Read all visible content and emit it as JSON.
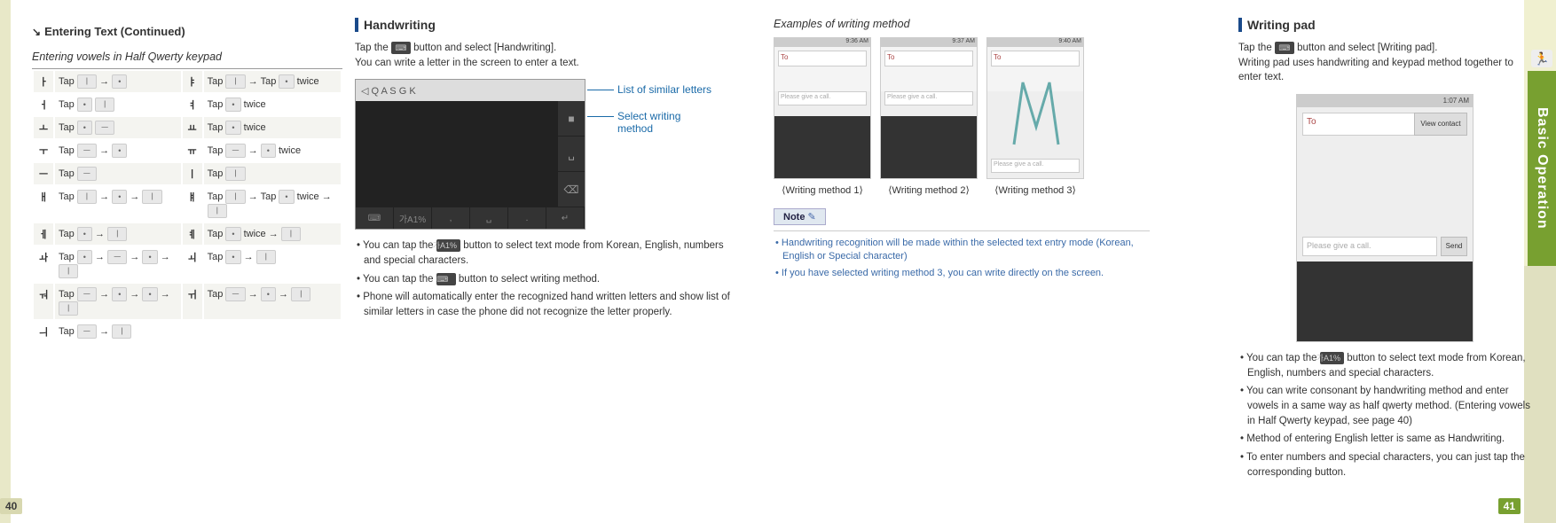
{
  "header": {
    "continued": "Entering Text (Continued)"
  },
  "left": {
    "subtitle": "Entering vowels in Half Qwerty keypad",
    "rows": [
      {
        "c1": "ㅏ",
        "t1": "Tap [ㅣ] → [•]",
        "c2": "ㅑ",
        "t2": "Tap [ㅣ] → Tap [•] twice"
      },
      {
        "c1": "ㅓ",
        "t1": "Tap [•] [ㅣ]",
        "c2": "ㅕ",
        "t2": "Tap [•] twice"
      },
      {
        "c1": "ㅗ",
        "t1": "Tap [•] [ㅡ]",
        "c2": "ㅛ",
        "t2": "Tap [•] twice"
      },
      {
        "c1": "ㅜ",
        "t1": "Tap [ㅡ] → [•]",
        "c2": "ㅠ",
        "t2": "Tap [ㅡ] → [•] twice"
      },
      {
        "c1": "ㅡ",
        "t1": "Tap [ㅡ]",
        "c2": "ㅣ",
        "t2": "Tap [ㅣ]"
      },
      {
        "c1": "ㅐ",
        "t1": "Tap [ㅣ] → [•] → [ㅣ]",
        "c2": "ㅒ",
        "t2": "Tap [ㅣ] → Tap [•] twice → [ㅣ]"
      },
      {
        "c1": "ㅔ",
        "t1": "Tap [•] → [ㅣ]",
        "c2": "ㅖ",
        "t2": "Tap [•] twice → [ㅣ]"
      },
      {
        "c1": "ㅘ",
        "t1": "Tap [•] → [ㅡ] → [•] → [ㅣ]",
        "c2": "ㅚ",
        "t2": "Tap [•] → [ㅣ]"
      },
      {
        "c1": "ㅝ",
        "t1": "Tap [ㅡ] → [•] → [•] → [ㅣ]",
        "c2": "ㅟ",
        "t2": "Tap [ㅡ] → [•] → [ㅣ]"
      },
      {
        "c1": "ㅢ",
        "t1": "Tap [ㅡ] → [ㅣ]",
        "c2": "",
        "t2": ""
      }
    ]
  },
  "handwriting": {
    "heading": "Handwriting",
    "intro1_a": "Tap the ",
    "intro1_btn": "⌨",
    "intro1_b": " button and select [Handwriting].",
    "intro2": "You can write a letter in the screen to enter a text.",
    "callout1": "List of similar letters",
    "callout2": "Select writing method",
    "topletters": "◁  Q  A  S  G  K",
    "bullets": [
      "You can tap the [가A1%] button to select text mode from Korean, English, numbers and special characters.",
      "You can tap the [⌨] button to select writing method.",
      "Phone will automatically enter the recognized hand written letters and show list of similar letters in case the phone did not recognize the letter properly."
    ]
  },
  "examples": {
    "heading": "Examples of writing method",
    "times": [
      "9:36 AM",
      "9:37 AM",
      "9:40 AM"
    ],
    "to": "To",
    "msg": "Please give a call.",
    "captions": [
      "⟨Writing method 1⟩",
      "⟨Writing method 2⟩",
      "⟨Writing method 3⟩"
    ],
    "noteLabel": "Note",
    "notes": [
      "Handwriting recognition will be made within the selected text entry mode (Korean, English or Special character)",
      "If you have selected writing method 3, you can write directly on the screen."
    ]
  },
  "writingpad": {
    "heading": "Writing pad",
    "intro1_a": "Tap the ",
    "intro1_btn": "⌨",
    "intro1_b": " button and select [Writing pad].",
    "intro2": "Writing pad uses handwriting and keypad method together to enter text.",
    "time": "1:07 AM",
    "to": "To",
    "viewcontact": "View contact",
    "msg": "Please give a call.",
    "send": "Send",
    "bullets": [
      "You can tap the [가A1%] button to select text mode from Korean, English, numbers and special characters.",
      "You can write consonant by handwriting method and enter vowels in a same way as half qwerty method. (Entering vowels in Half Qwerty keypad, see page 40)",
      "Method of entering English letter is same as Handwriting.",
      "To enter numbers and special characters, you can just tap the corresponding button."
    ]
  },
  "sidetab": "Basic Operation",
  "pagenums": {
    "left": "40",
    "right": "41"
  }
}
